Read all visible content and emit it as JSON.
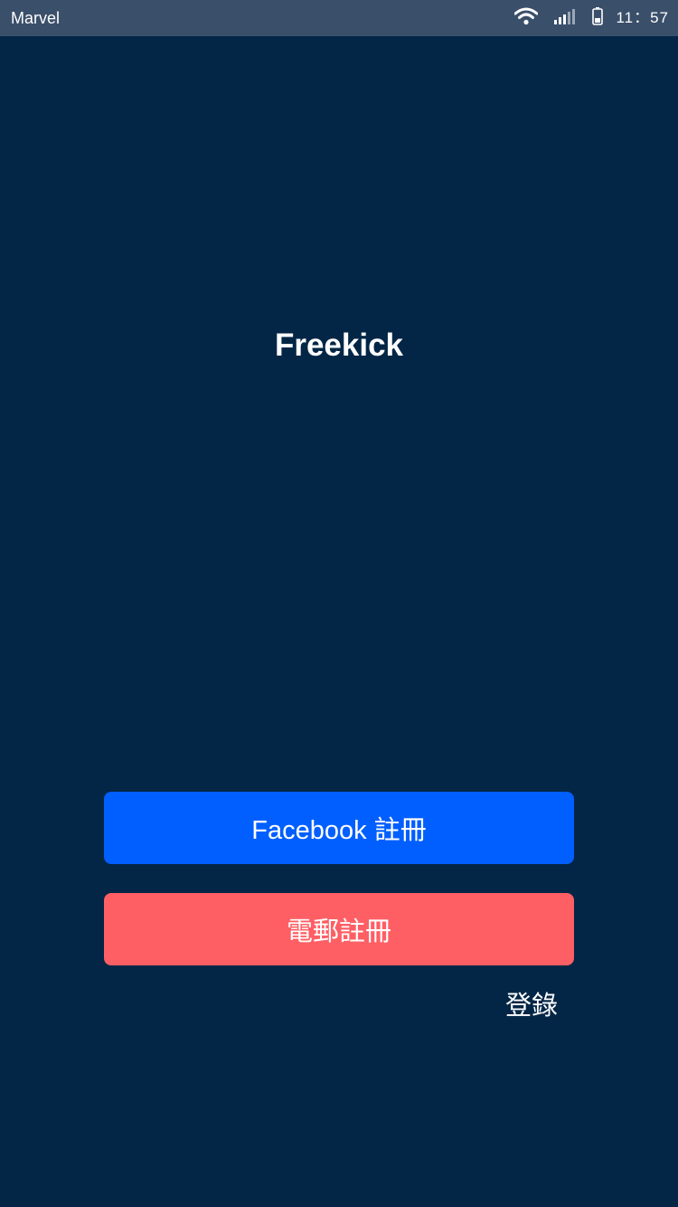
{
  "status_bar": {
    "carrier": "Marvel",
    "time": "11：57",
    "icons": [
      "wifi-icon",
      "signal-icon",
      "battery-icon"
    ]
  },
  "app": {
    "title": "Freekick"
  },
  "actions": {
    "facebook_signup_label": "Facebook 註冊",
    "email_signup_label": "電郵註冊",
    "login_label": "登錄"
  },
  "colors": {
    "background": "#032646",
    "status_bar": "#3a4f6a",
    "facebook_button": "#005ffe",
    "email_button": "#fe5f64",
    "text": "#ffffff"
  }
}
